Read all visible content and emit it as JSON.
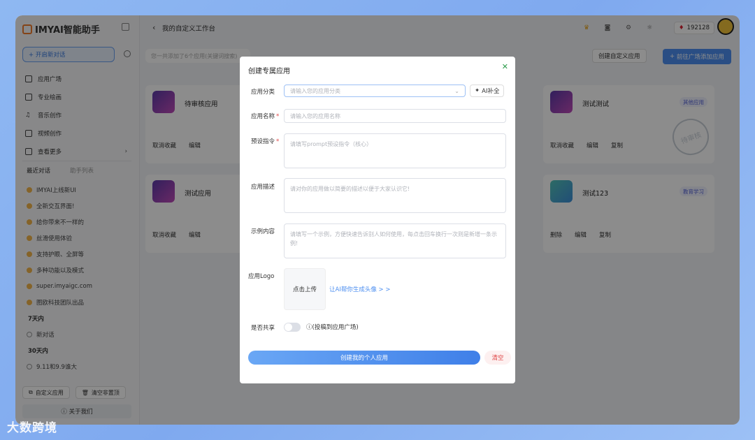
{
  "sidebar": {
    "logo_text": "IMYAI智能助手",
    "new_chat_label": "+ 开启新对话",
    "menu": [
      {
        "label": "应用广场"
      },
      {
        "label": "专业绘画"
      },
      {
        "label": "音乐创作"
      },
      {
        "label": "视频创作"
      },
      {
        "label": "查看更多"
      }
    ],
    "tab_recent": "最近对话",
    "tab_assistant": "助手列表",
    "chats_today": [
      "IMYAI上线新UI",
      "全新交互界面!",
      "给你带来不一样的",
      "丝滑使用体验",
      "支持护眼、全屏等",
      "多种功能以及模式",
      "super.imyaigc.com",
      "图欧科技团队出品"
    ],
    "group_7days": "7天内",
    "chats_7days": [
      "新对话"
    ],
    "group_30days": "30天内",
    "chats_30days": [
      "9.11和9.9谁大"
    ],
    "btn_custom_app": "自定义应用",
    "btn_clear_unpinned": "清空非置顶",
    "about": "关于我们"
  },
  "topbar": {
    "title": "我的自定义工作台",
    "points": "192128"
  },
  "main": {
    "search_placeholder": "您一共添加了6个应用(关键词搜索)",
    "create_custom_app": "创建自定义应用",
    "goto_square": "前往广场添加应用",
    "cards": [
      {
        "name": "待审核应用",
        "actions": [
          "取消收藏",
          "编辑"
        ]
      },
      {
        "name": "测试测试",
        "tag": "其他应用",
        "actions": [
          "取消收藏",
          "编辑",
          "复制"
        ],
        "stamp": "待审核"
      },
      {
        "name": "测试应用",
        "actions": [
          "取消收藏",
          "编辑"
        ]
      },
      {
        "name": "测试123",
        "tag": "教育学习",
        "actions": [
          "删除",
          "编辑",
          "复制"
        ]
      }
    ]
  },
  "modal": {
    "title": "创建专属应用",
    "category_label": "应用分类",
    "category_placeholder": "请输入您的应用分类",
    "ai_fill": "AI补全",
    "name_label": "应用名称",
    "name_placeholder": "请输入您的应用名称",
    "prompt_label": "预设指令",
    "prompt_placeholder": "请填写prompt预设指令（核心）",
    "desc_label": "应用描述",
    "desc_placeholder": "请对你的应用做以简要的描述以便于大家认识它!",
    "example_label": "示例内容",
    "example_placeholder": "请填写一个示例，方便快速告诉别人如何使用，每点击回车换行一次则是新增一条示例!",
    "logo_label": "应用Logo",
    "upload": "点击上传",
    "ai_avatar": "让AI帮你生成头像 > >",
    "share_label": "是否共享",
    "share_hint": "(投稿到应用广场)",
    "submit": "创建我的个人应用",
    "clear": "清空"
  },
  "watermark": "大数跨境"
}
